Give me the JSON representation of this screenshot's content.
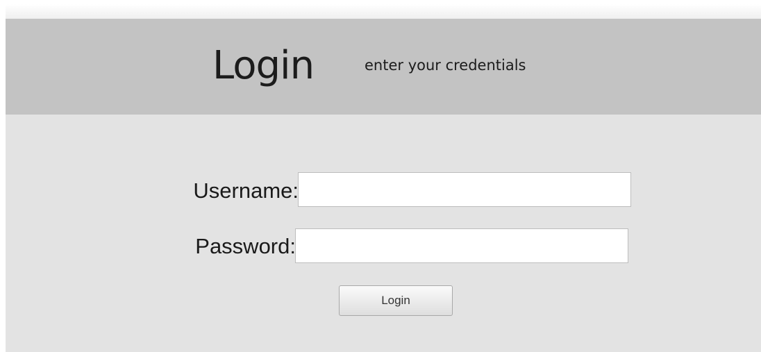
{
  "header": {
    "title": "Login",
    "subtitle": "enter your credentials"
  },
  "form": {
    "username_label": "Username:",
    "username_value": "",
    "password_label": "Password:",
    "password_value": "",
    "submit_label": "Login"
  }
}
